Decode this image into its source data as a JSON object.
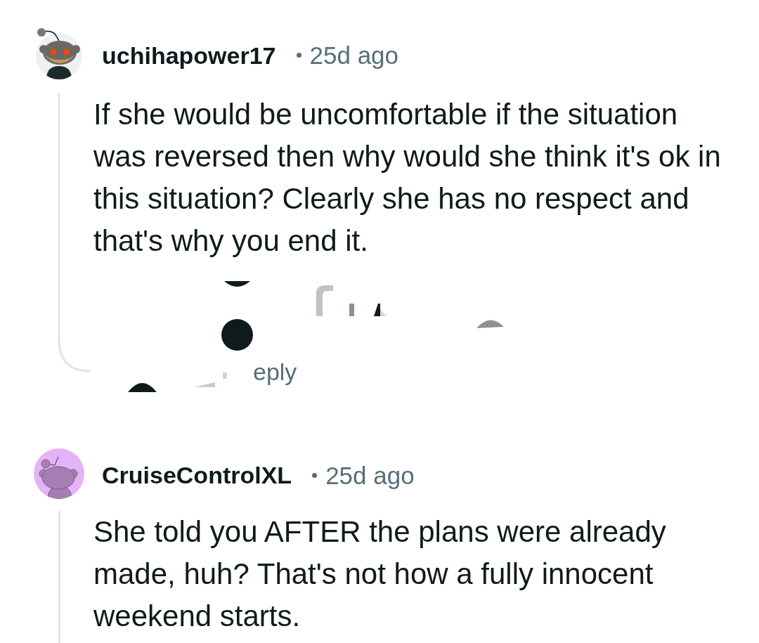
{
  "comments": [
    {
      "avatar": {
        "kind": "custom"
      },
      "author": "uchihapower17",
      "age": "25d ago",
      "body": "If she would be uncomfortable if the situation was reversed then why would she think it's ok in this situation? Clearly she has no respect and that's why you end it.",
      "erased_action_bar": {
        "label_fragment": "eply"
      }
    },
    {
      "avatar": {
        "kind": "default"
      },
      "author": "CruiseControlXL",
      "age": "25d ago",
      "body": "She told you AFTER the plans were already made, huh? That's not how a fully innocent weekend starts."
    }
  ]
}
